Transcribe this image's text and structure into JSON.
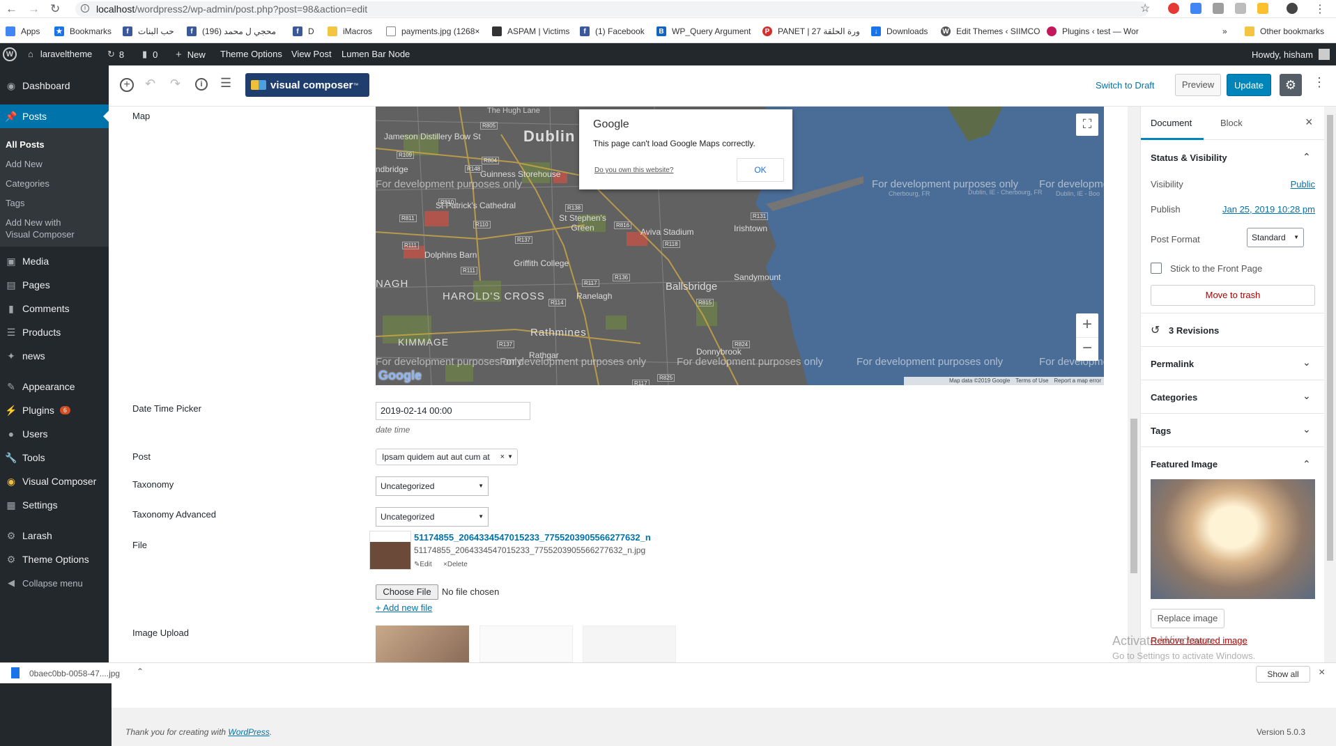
{
  "browser": {
    "url_host": "localhost",
    "url_path": "/wordpress2/wp-admin/post.php?post=98&action=edit",
    "bookmarks": [
      {
        "label": "Apps",
        "icon": "apps-icon",
        "color": "#4285f4"
      },
      {
        "label": "Bookmarks",
        "icon": "star-icon",
        "color": "#1a73e8"
      },
      {
        "label": "حب البنات",
        "icon": "facebook-icon",
        "color": "#3b5998"
      },
      {
        "label": "(196) محجي ل محمد",
        "icon": "facebook-icon",
        "color": "#3b5998"
      },
      {
        "label": "D",
        "icon": "facebook-icon",
        "color": "#3b5998"
      },
      {
        "label": "iMacros",
        "icon": "folder-icon",
        "color": "#f4c542"
      },
      {
        "label": "payments.jpg (1268×",
        "icon": "page-icon",
        "color": "#888888"
      },
      {
        "label": "ASPAM | Victims",
        "icon": "aspam-icon",
        "color": "#333333"
      },
      {
        "label": "(1) Facebook",
        "icon": "facebook-icon",
        "color": "#3b5998"
      },
      {
        "label": "WP_Query Argument",
        "icon": "b-icon",
        "color": "#1565c0"
      },
      {
        "label": "PANET | 27 ورة الحلقة",
        "icon": "panet-icon",
        "color": "#d32f2f"
      },
      {
        "label": "Downloads",
        "icon": "download-icon",
        "color": "#1a73e8"
      },
      {
        "label": "Edit Themes ‹ SIIMCO",
        "icon": "wp-icon",
        "color": "#555555"
      },
      {
        "label": "Plugins ‹ test — Wor",
        "icon": "plugin-icon",
        "color": "#c2185b"
      }
    ],
    "overflow_label": "»",
    "other_bookmarks": "Other bookmarks"
  },
  "adminbar": {
    "site_name": "laraveltheme",
    "updates_count": "8",
    "comments_count": "0",
    "new_label": "New",
    "theme_options": "Theme Options",
    "view_post": "View Post",
    "lumen_bar": "Lumen Bar Node",
    "howdy": "Howdy, hisham"
  },
  "sidebar": {
    "dashboard": "Dashboard",
    "posts": "Posts",
    "sub": [
      "All Posts",
      "Add New",
      "Categories",
      "Tags",
      "Add New with",
      "Visual Composer"
    ],
    "items": [
      {
        "label": "Media",
        "icon": "media-icon"
      },
      {
        "label": "Pages",
        "icon": "pages-icon"
      },
      {
        "label": "Comments",
        "icon": "comments-icon"
      },
      {
        "label": "Products",
        "icon": "products-icon"
      },
      {
        "label": "news",
        "icon": "pin-icon"
      },
      {
        "label": "Appearance",
        "icon": "appearance-icon"
      },
      {
        "label": "Plugins",
        "icon": "plugins-icon"
      },
      {
        "label": "Users",
        "icon": "users-icon"
      },
      {
        "label": "Tools",
        "icon": "tools-icon"
      },
      {
        "label": "Visual Composer",
        "icon": "vc-icon"
      },
      {
        "label": "Settings",
        "icon": "settings-icon"
      },
      {
        "label": "Larash",
        "icon": "gear-icon"
      },
      {
        "label": "Theme Options",
        "icon": "gear-icon"
      },
      {
        "label": "Collapse menu",
        "icon": "collapse-icon"
      }
    ],
    "plugins_badge": "6"
  },
  "editor": {
    "vc_label": "visual composer",
    "vc_tm": "™",
    "switch_draft": "Switch to Draft",
    "preview": "Preview",
    "update": "Update"
  },
  "fields": {
    "map_label": "Map",
    "map": {
      "city": "Dublin",
      "places": [
        "The Hugh Lane",
        "Jameson Distillery Bow St",
        "Guinness Storehouse",
        "St Patrick's Cathedral",
        "St Stephen's Green",
        "Aviva Stadium",
        "Irishtown",
        "Dolphins Barn",
        "Griffith College",
        "Ranelagh",
        "Ballsbridge",
        "Sandymount",
        "HAROLD'S CROSS",
        "Rathmines",
        "KIMMAGE",
        "Rathgar",
        "Donnybrook",
        "NAGH",
        "ndbridge"
      ],
      "roads": [
        "R109",
        "R805",
        "R804",
        "R148",
        "R810",
        "R138",
        "R811",
        "R110",
        "R816",
        "R131",
        "R137",
        "R111",
        "R118",
        "R136",
        "R114",
        "R117",
        "R815",
        "R137",
        "R824",
        "R117",
        "R825",
        "R111"
      ],
      "dev_text": "For development purposes only",
      "map_data": "Map data ©2019 Google",
      "terms": "Terms of Use",
      "report": "Report a map error",
      "google": "Google",
      "dialog_title": "Google",
      "dialog_message": "This page can't load Google Maps correctly.",
      "dialog_link": "Do you own this website?",
      "dialog_ok": "OK",
      "cherbourg": "Cherbourg, FR",
      "dublin_ie": "Dublin, IE - Cherbourg, FR",
      "dublin_ie2": "Dublin, IE - Boo"
    },
    "date_label": "Date Time Picker",
    "date_value": "2019-02-14 00:00",
    "date_hint": "date time",
    "post_label": "Post",
    "post_value": "Ipsam quidem aut aut cum at",
    "taxonomy_label": "Taxonomy",
    "taxonomy_value": "Uncategorized",
    "taxonomy_adv_label": "Taxonomy Advanced",
    "taxonomy_adv_value": "Uncategorized",
    "file_label": "File",
    "file_title": "51174855_2064334547015233_7755203905566277632_n",
    "file_name": "51174855_2064334547015233_7755203905566277632_n.jpg",
    "file_edit": "Edit",
    "file_delete": "Delete",
    "choose_file": "Choose File",
    "no_file": "No file chosen",
    "add_new_file": "+ Add new file",
    "image_upload_label": "Image Upload"
  },
  "panel": {
    "tab_document": "Document",
    "tab_block": "Block",
    "status_visibility": "Status & Visibility",
    "visibility_label": "Visibility",
    "visibility_value": "Public",
    "publish_label": "Publish",
    "publish_value": "Jan 25, 2019 10:28 pm",
    "post_format_label": "Post Format",
    "post_format_value": "Standard",
    "stick_label": "Stick to the Front Page",
    "move_trash": "Move to trash",
    "revisions": "3 Revisions",
    "permalink": "Permalink",
    "categories": "Categories",
    "tags": "Tags",
    "featured_image": "Featured Image",
    "replace_image": "Replace image",
    "remove_image": "Remove featured image",
    "activate_1": "Activate Windows",
    "activate_2": "Go to Settings to activate Windows."
  },
  "downloads": {
    "file": "0baec0bb-0058-47....jpg",
    "show_all": "Show all"
  },
  "footer": {
    "thanks": "Thank you for creating with ",
    "wp_link": "WordPress",
    "period": ".",
    "version": "Version 5.0.3"
  },
  "colors": {
    "wp_blue": "#0085ba",
    "admin_dark": "#23282d",
    "link": "#0073aa",
    "trash": "#a00",
    "map_water": "#4a6d97",
    "map_land": "#5a5a5a"
  }
}
